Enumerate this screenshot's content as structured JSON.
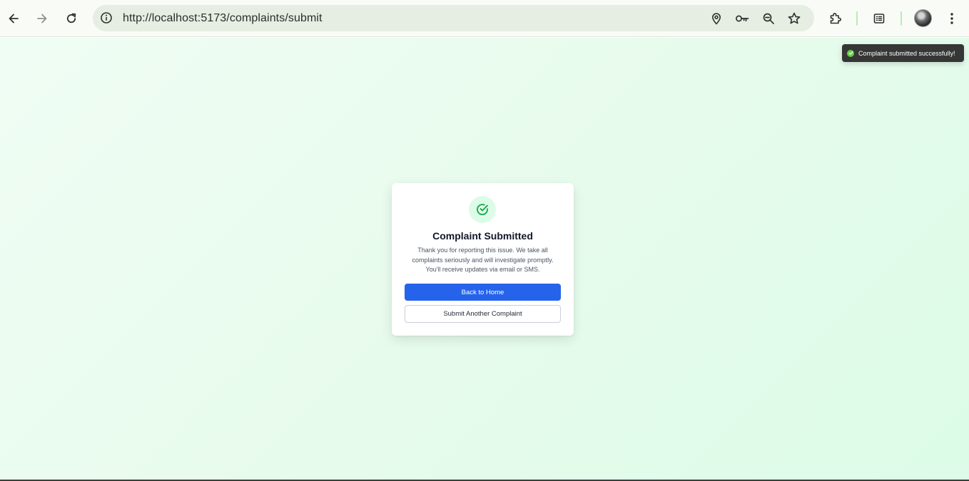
{
  "browser": {
    "url": "http://localhost:5173/complaints/submit",
    "icons": {
      "back": "arrow-left-icon",
      "forward": "arrow-right-icon",
      "reload": "reload-icon",
      "site_info": "info-icon",
      "location": "location-pin-icon",
      "passwords": "key-icon",
      "zoom": "zoom-out-icon",
      "bookmark": "star-icon",
      "extensions": "puzzle-icon",
      "reading_list": "reading-list-icon",
      "profile": "avatar",
      "menu": "kebab-menu-icon"
    }
  },
  "card": {
    "title": "Complaint Submitted",
    "message": "Thank you for reporting this issue. We take all complaints seriously and will investigate promptly. You'll receive updates via email or SMS.",
    "primary_button": "Back to Home",
    "secondary_button": "Submit Another Complaint",
    "icon": "check-circle-icon"
  },
  "toast": {
    "message": "Complaint submitted successfully!",
    "icon": "check-icon"
  },
  "colors": {
    "primary": "#2563eb",
    "success": "#16a34a",
    "success_bg": "#dcfce7",
    "page_bg": "#f0fdf4",
    "toast_bg": "#363636"
  }
}
